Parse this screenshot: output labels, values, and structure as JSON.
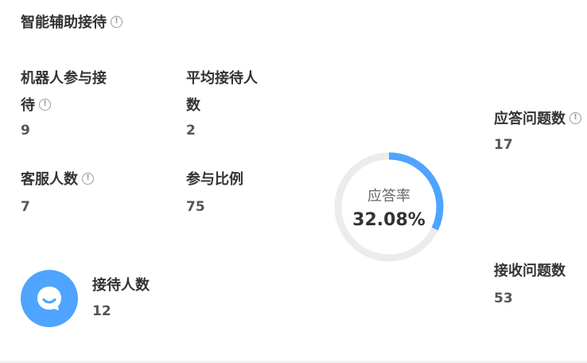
{
  "section": {
    "title": "智能辅助接待"
  },
  "stats": {
    "robot_participate": {
      "label_line1": "机器人参与接",
      "label_line2": "待",
      "value": "9"
    },
    "avg_reception": {
      "label_line1": "平均接待人",
      "label_line2": "数",
      "value": "2"
    },
    "agent_count": {
      "label": "客服人数",
      "value": "7"
    },
    "participation_ratio": {
      "label": "参与比例",
      "value": "75"
    },
    "reception_count": {
      "label": "接待人数",
      "value": "12"
    },
    "answered_questions": {
      "label": "应答问题数",
      "value": "17"
    },
    "received_questions": {
      "label": "接收问题数",
      "value": "53"
    }
  },
  "donut": {
    "label": "应答率",
    "value_text": "32.08%",
    "percent": 32.08,
    "colors": {
      "fill": "#4ea4ff",
      "track": "#ececec"
    }
  },
  "colors": {
    "accent": "#4ea4ff",
    "icon_gray": "#9a9a9a"
  }
}
